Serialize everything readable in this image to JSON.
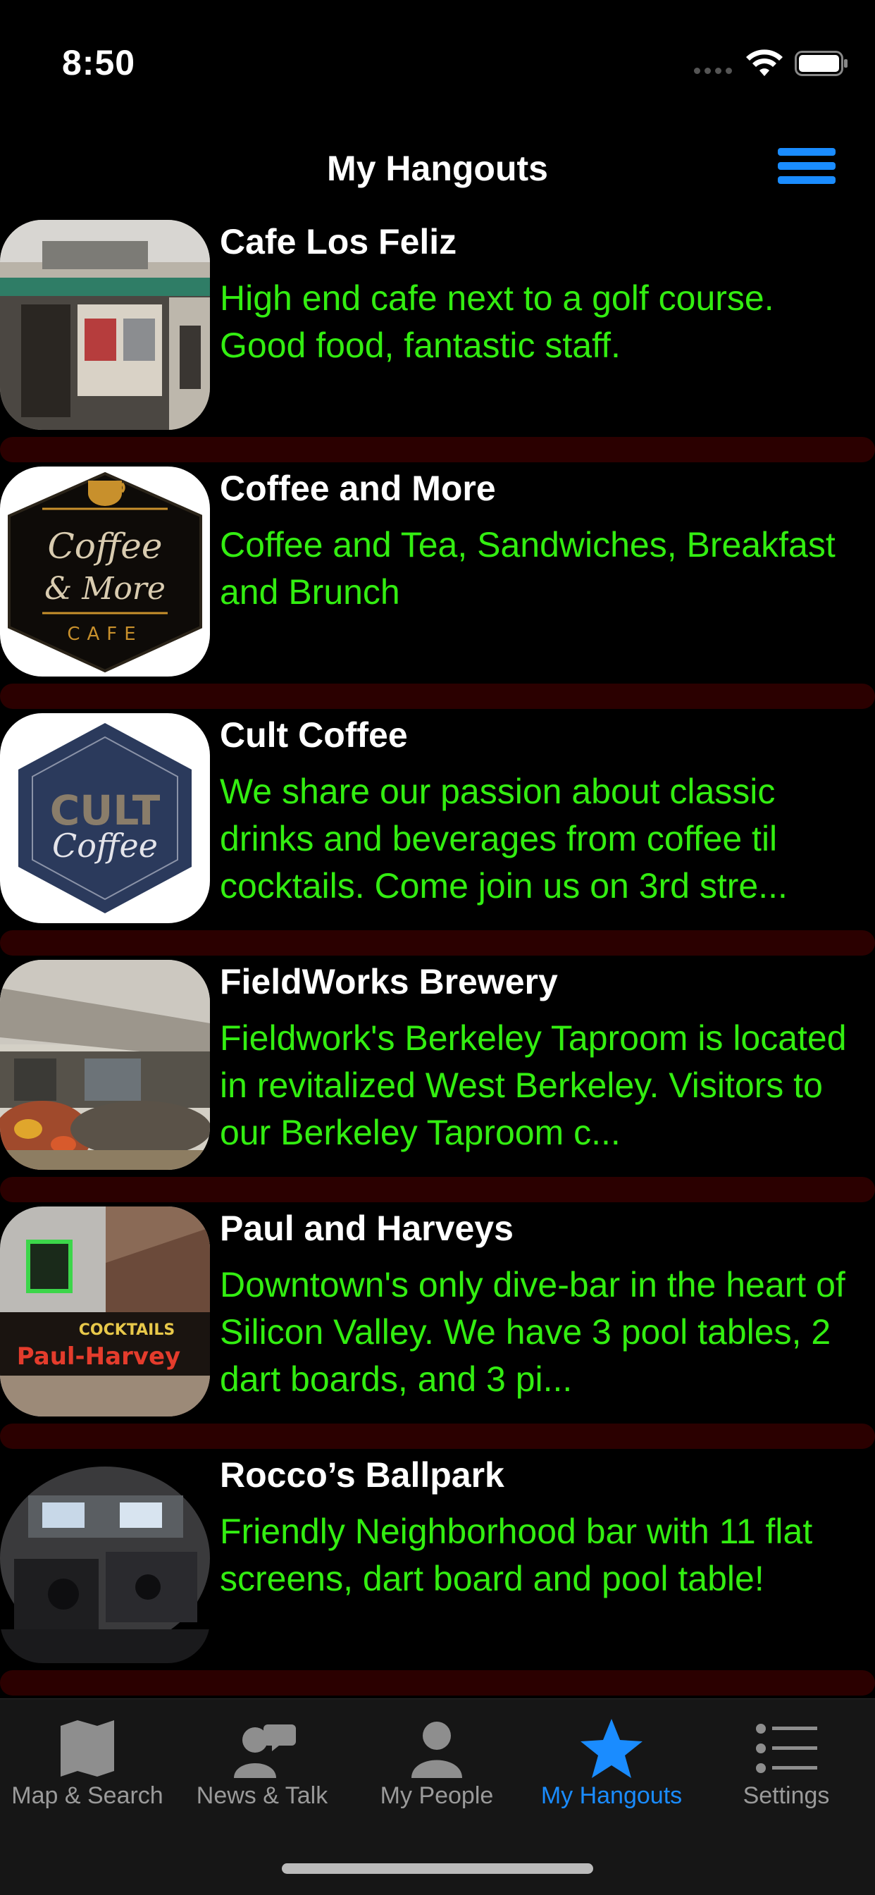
{
  "status": {
    "time": "8:50"
  },
  "nav": {
    "title": "My Hangouts",
    "menu_icon": "hamburger-menu-icon"
  },
  "colors": {
    "accent": "#1a8cff",
    "description": "#33ee11",
    "separator": "#2b0000",
    "tab_inactive": "#9a9a9a",
    "background": "#000000"
  },
  "hangouts": [
    {
      "name": "Cafe Los Feliz",
      "description": "High end cafe next to a golf course. Good food, fantastic staff.",
      "image": "storefront-photo"
    },
    {
      "name": "Coffee and More",
      "description": "Coffee and Tea, Sandwiches, Breakfast and Brunch",
      "image": "coffee-and-more-logo",
      "logo_line1": "Coffee",
      "logo_line2": "& More",
      "logo_line3": "CAFE"
    },
    {
      "name": "Cult Coffee",
      "description": "We share our passion about classic drinks and beverages from coffee til cocktails. Come join us on 3rd stre...",
      "image": "cult-coffee-logo",
      "logo_line1": "CULT",
      "logo_line2": "Coffee"
    },
    {
      "name": "FieldWorks Brewery",
      "description": "Fieldwork's Berkeley Taproom is located in revitalized West Berkeley. Visitors to our Berkeley Taproom c...",
      "image": "brewery-patio-photo"
    },
    {
      "name": "Paul and Harveys",
      "description": "Downtown's only dive-bar in the heart of Silicon Valley.   We have 3 pool tables, 2 dart boards, and 3 pi...",
      "image": "neon-sign-photo",
      "sign_line1": "COCKTAILS",
      "sign_line2": "Paul-Harvey"
    },
    {
      "name": "Rocco’s Ballpark",
      "description": "Friendly Neighborhood bar with 11 flat screens, dart board and pool table!",
      "image": "bar-interior-photo"
    }
  ],
  "tabs": [
    {
      "label": "Map & Search",
      "icon": "map-icon",
      "active": false
    },
    {
      "label": "News & Talk",
      "icon": "chat-person-icon",
      "active": false
    },
    {
      "label": "My People",
      "icon": "person-icon",
      "active": false
    },
    {
      "label": "My Hangouts",
      "icon": "star-icon",
      "active": true
    },
    {
      "label": "Settings",
      "icon": "list-icon",
      "active": false
    }
  ]
}
